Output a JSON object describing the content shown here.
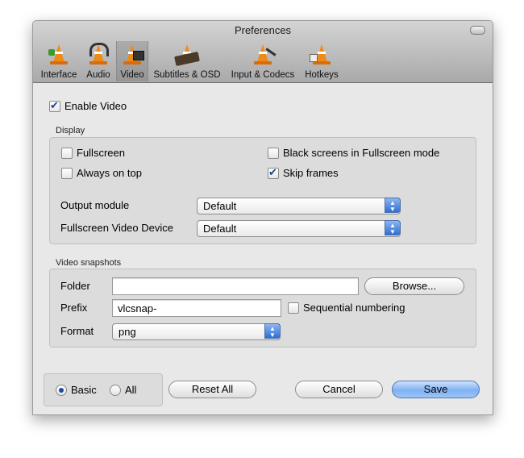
{
  "window": {
    "title": "Preferences"
  },
  "tabs": [
    {
      "label": "Interface",
      "icon": "cone-icon"
    },
    {
      "label": "Audio",
      "icon": "headphones-cone-icon"
    },
    {
      "label": "Video",
      "icon": "film-cone-icon",
      "active": true
    },
    {
      "label": "Subtitles & OSD",
      "icon": "subtitles-icon"
    },
    {
      "label": "Input & Codecs",
      "icon": "cable-cone-icon"
    },
    {
      "label": "Hotkeys",
      "icon": "hotkeys-cone-icon"
    }
  ],
  "enable_video": {
    "label": "Enable Video",
    "checked": true
  },
  "display": {
    "group_label": "Display",
    "fullscreen": {
      "label": "Fullscreen",
      "checked": false
    },
    "always_on_top": {
      "label": "Always on top",
      "checked": false
    },
    "black_screens": {
      "label": "Black screens in Fullscreen mode",
      "checked": false
    },
    "skip_frames": {
      "label": "Skip frames",
      "checked": true
    },
    "output_module": {
      "label": "Output module",
      "value": "Default"
    },
    "fullscreen_device": {
      "label": "Fullscreen Video Device",
      "value": "Default"
    }
  },
  "snapshots": {
    "group_label": "Video snapshots",
    "folder": {
      "label": "Folder",
      "value": ""
    },
    "browse_button": "Browse...",
    "prefix": {
      "label": "Prefix",
      "value": "vlcsnap-"
    },
    "sequential": {
      "label": "Sequential numbering",
      "checked": false
    },
    "format": {
      "label": "Format",
      "value": "png"
    }
  },
  "footer": {
    "basic": {
      "label": "Basic",
      "selected": true
    },
    "all": {
      "label": "All",
      "selected": false
    },
    "reset_button": "Reset All",
    "cancel_button": "Cancel",
    "save_button": "Save"
  },
  "colors": {
    "accent": "#2e6fd6",
    "cone": "#f08a17"
  }
}
